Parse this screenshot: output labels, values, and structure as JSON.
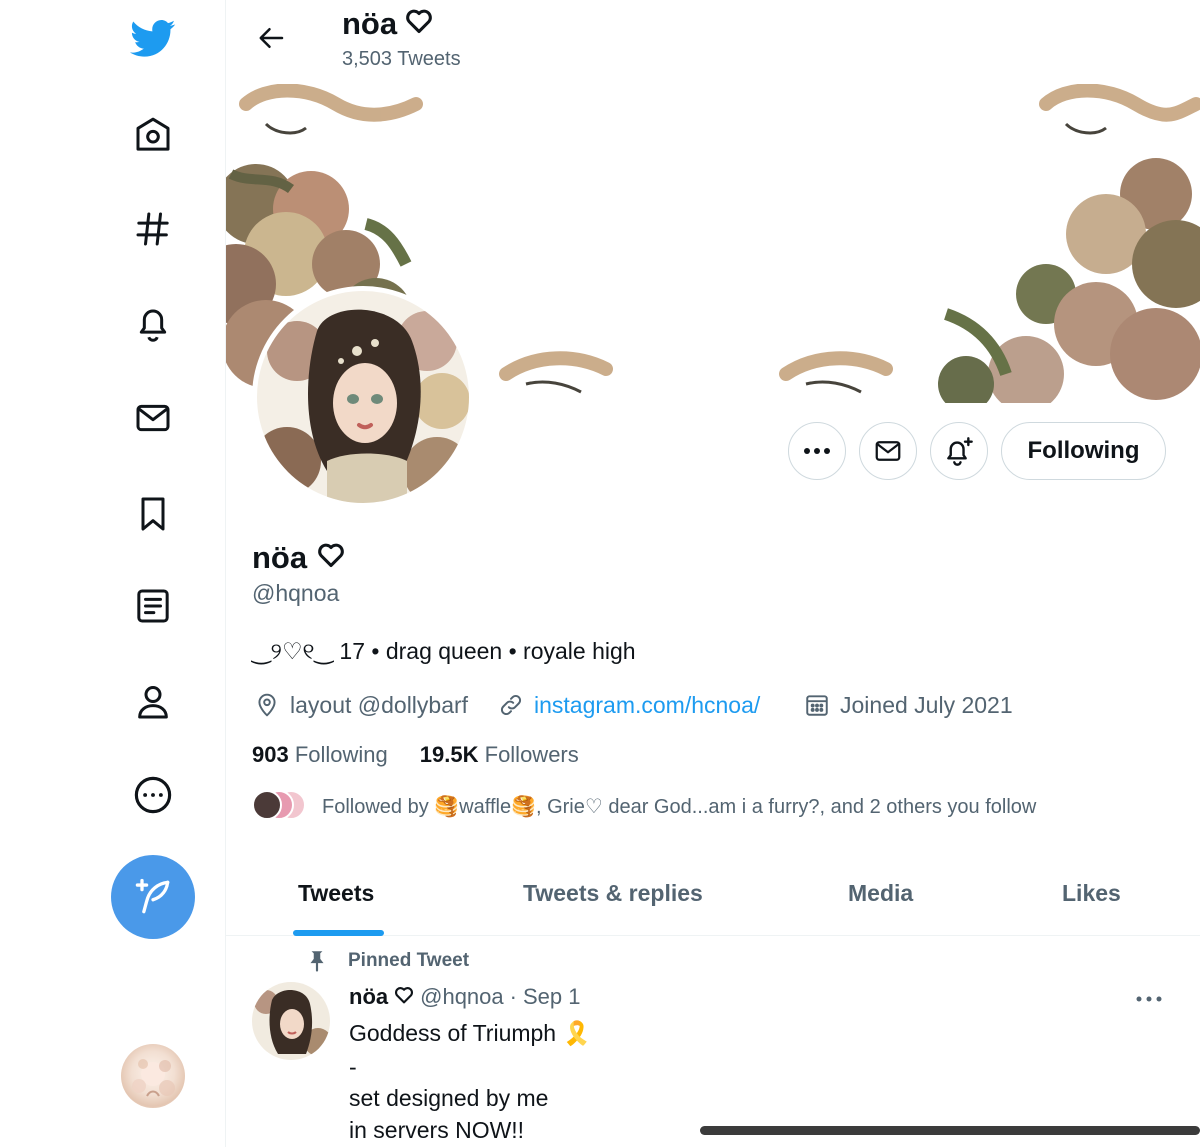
{
  "sidebar": {
    "icons": [
      "twitter-bird-icon",
      "home-icon",
      "hashtag-icon",
      "bell-icon",
      "mail-icon",
      "bookmark-icon",
      "list-icon",
      "person-icon",
      "more-circle-icon"
    ],
    "compose_icon": "compose-feather-icon",
    "brand_color": "#1d9bf0"
  },
  "header": {
    "name": "nöa",
    "heart": "♡",
    "tweet_count": "3,503 Tweets"
  },
  "profile": {
    "name": "nöa",
    "heart": "♡",
    "handle": "@hqnoa",
    "bio": "‿୨♡୧‿ 17 • drag queen • royale high",
    "location": "layout @dollybarf",
    "website": "instagram.com/hcnoa/",
    "joined": "Joined July 2021",
    "following_count": "903",
    "following_label": "Following",
    "followers_count": "19.5K",
    "followers_label": "Followers",
    "followed_by": "Followed by 🥞waffle🥞, Grie♡ dear God...am i a furry?, and 2 others you follow",
    "follow_button": "Following"
  },
  "tabs": [
    {
      "label": "Tweets",
      "active": true
    },
    {
      "label": "Tweets & replies",
      "active": false
    },
    {
      "label": "Media",
      "active": false
    },
    {
      "label": "Likes",
      "active": false
    }
  ],
  "pinned_tweet": {
    "label": "Pinned Tweet",
    "name": "nöa",
    "heart": "♡",
    "handle": "@hqnoa",
    "dot": "·",
    "date": "Sep 1",
    "lines": [
      "Goddess of Triumph 🎗️",
      "-",
      "set designed by me",
      "in servers NOW!!"
    ]
  },
  "colors": {
    "accent": "#1d9bf0",
    "compose_button": "#4a99e9",
    "secondary_text": "#536471"
  }
}
